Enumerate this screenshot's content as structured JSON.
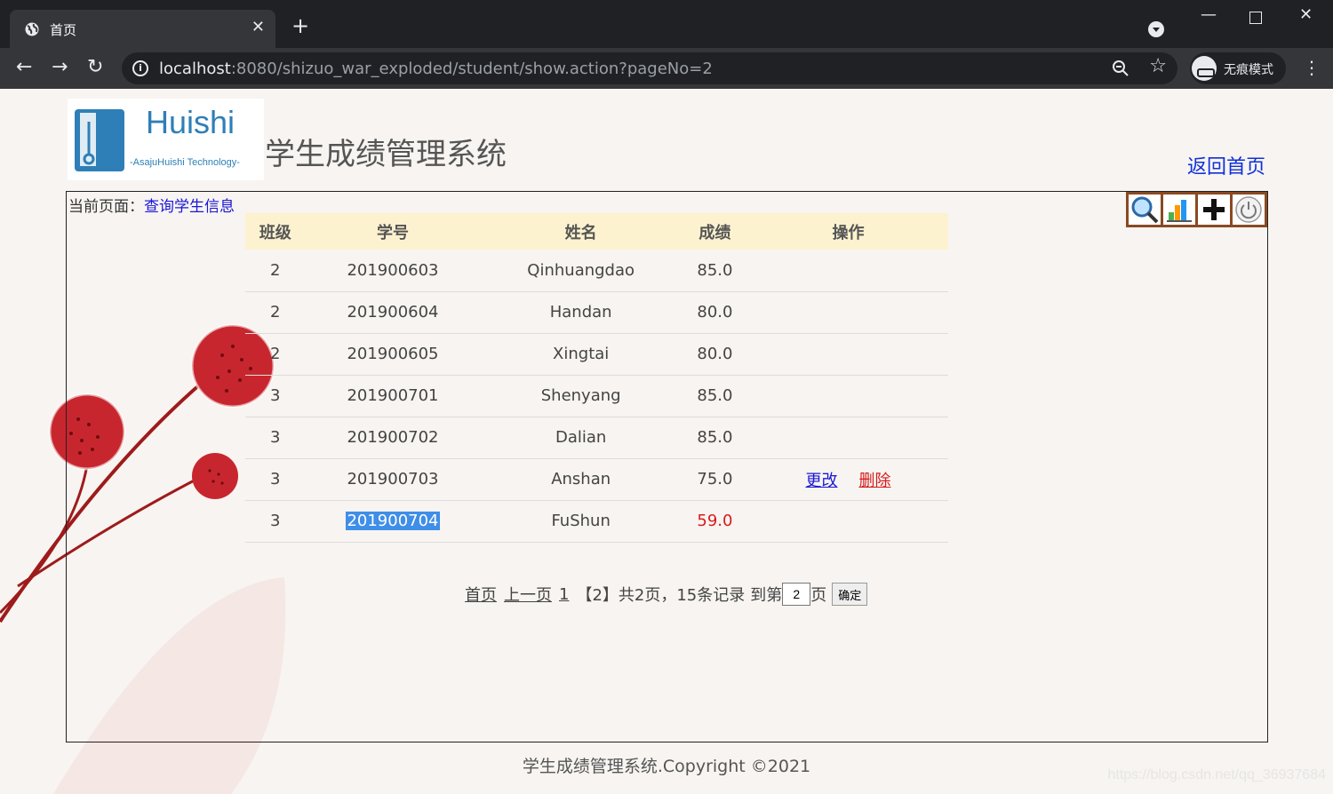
{
  "browser": {
    "tab_title": "首页",
    "tab_close": "✕",
    "new_tab": "+",
    "url_host": "localhost",
    "url_rest": ":8080/shizuo_war_exploded/student/show.action?pageNo=2",
    "incognito_label": "无痕模式"
  },
  "header": {
    "logo_text": "Huishi",
    "logo_subtext": "-AsajuHuishi Technology-",
    "system_title": "学生成绩管理系统",
    "home_link": "返回首页"
  },
  "breadcrumb": {
    "prefix": "当前页面：",
    "current": "查询学生信息"
  },
  "table": {
    "headers": [
      "班级",
      "学号",
      "姓名",
      "成绩",
      "操作"
    ],
    "rows": [
      {
        "class": "2",
        "id": "201900603",
        "name": "Qinhuangdao",
        "score": "85.0"
      },
      {
        "class": "2",
        "id": "201900604",
        "name": "Handan",
        "score": "80.0"
      },
      {
        "class": "2",
        "id": "201900605",
        "name": "Xingtai",
        "score": "80.0"
      },
      {
        "class": "3",
        "id": "201900701",
        "name": "Shenyang",
        "score": "85.0"
      },
      {
        "class": "3",
        "id": "201900702",
        "name": "Dalian",
        "score": "85.0"
      },
      {
        "class": "3",
        "id": "201900703",
        "name": "Anshan",
        "score": "75.0",
        "edit": "更改",
        "delete": "删除"
      },
      {
        "class": "3",
        "id": "201900704",
        "name": "FuShun",
        "score": "59.0"
      }
    ]
  },
  "pager": {
    "first": "首页",
    "prev": "上一页",
    "page1": "1",
    "current": "【2】",
    "summary": "共2页，15条记录",
    "goto_prefix": "到第",
    "goto_value": "2",
    "goto_suffix": "页",
    "confirm": "确定"
  },
  "footer": "学生成绩管理系统.Copyright ©2021",
  "watermark": "https://blog.csdn.net/qq_36937684",
  "colors": {
    "link_blue": "#1a18d6",
    "danger_red": "#d81b1b",
    "header_bg": "#fdf2cf",
    "toolbar_border": "#8a4a22"
  }
}
